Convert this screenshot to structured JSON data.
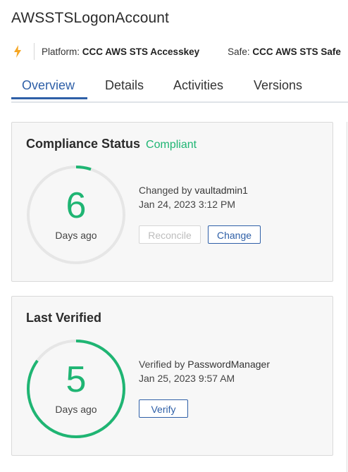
{
  "account": {
    "title": "AWSSTSLogonAccount",
    "platform_label": "Platform:",
    "platform_value": "CCC AWS STS Accesskey",
    "safe_label": "Safe:",
    "safe_value": "CCC AWS STS Safe",
    "type_icon": "lightning-bolt-icon"
  },
  "tabs": [
    {
      "label": "Overview",
      "active": true
    },
    {
      "label": "Details",
      "active": false
    },
    {
      "label": "Activities",
      "active": false
    },
    {
      "label": "Versions",
      "active": false
    }
  ],
  "compliance": {
    "title": "Compliance Status",
    "status": "Compliant",
    "days": "6",
    "days_label": "Days ago",
    "changed_by_label": "Changed by",
    "changed_by": "vaultadmin1",
    "changed_at": "Jan 24, 2023 3:12 PM",
    "reconcile_label": "Reconcile",
    "change_label": "Change",
    "ring_fill_fraction": 0.05
  },
  "verified": {
    "title": "Last Verified",
    "days": "5",
    "days_label": "Days ago",
    "verified_by_label": "Verified by",
    "verified_by": "PasswordManager",
    "verified_at": "Jan 25, 2023 9:57 AM",
    "verify_label": "Verify",
    "ring_fill_fraction": 0.85
  },
  "colors": {
    "accent": "#2e5fa7",
    "success": "#1fb573",
    "bolt": "#f5a623",
    "ring_track": "#e6e6e6"
  }
}
